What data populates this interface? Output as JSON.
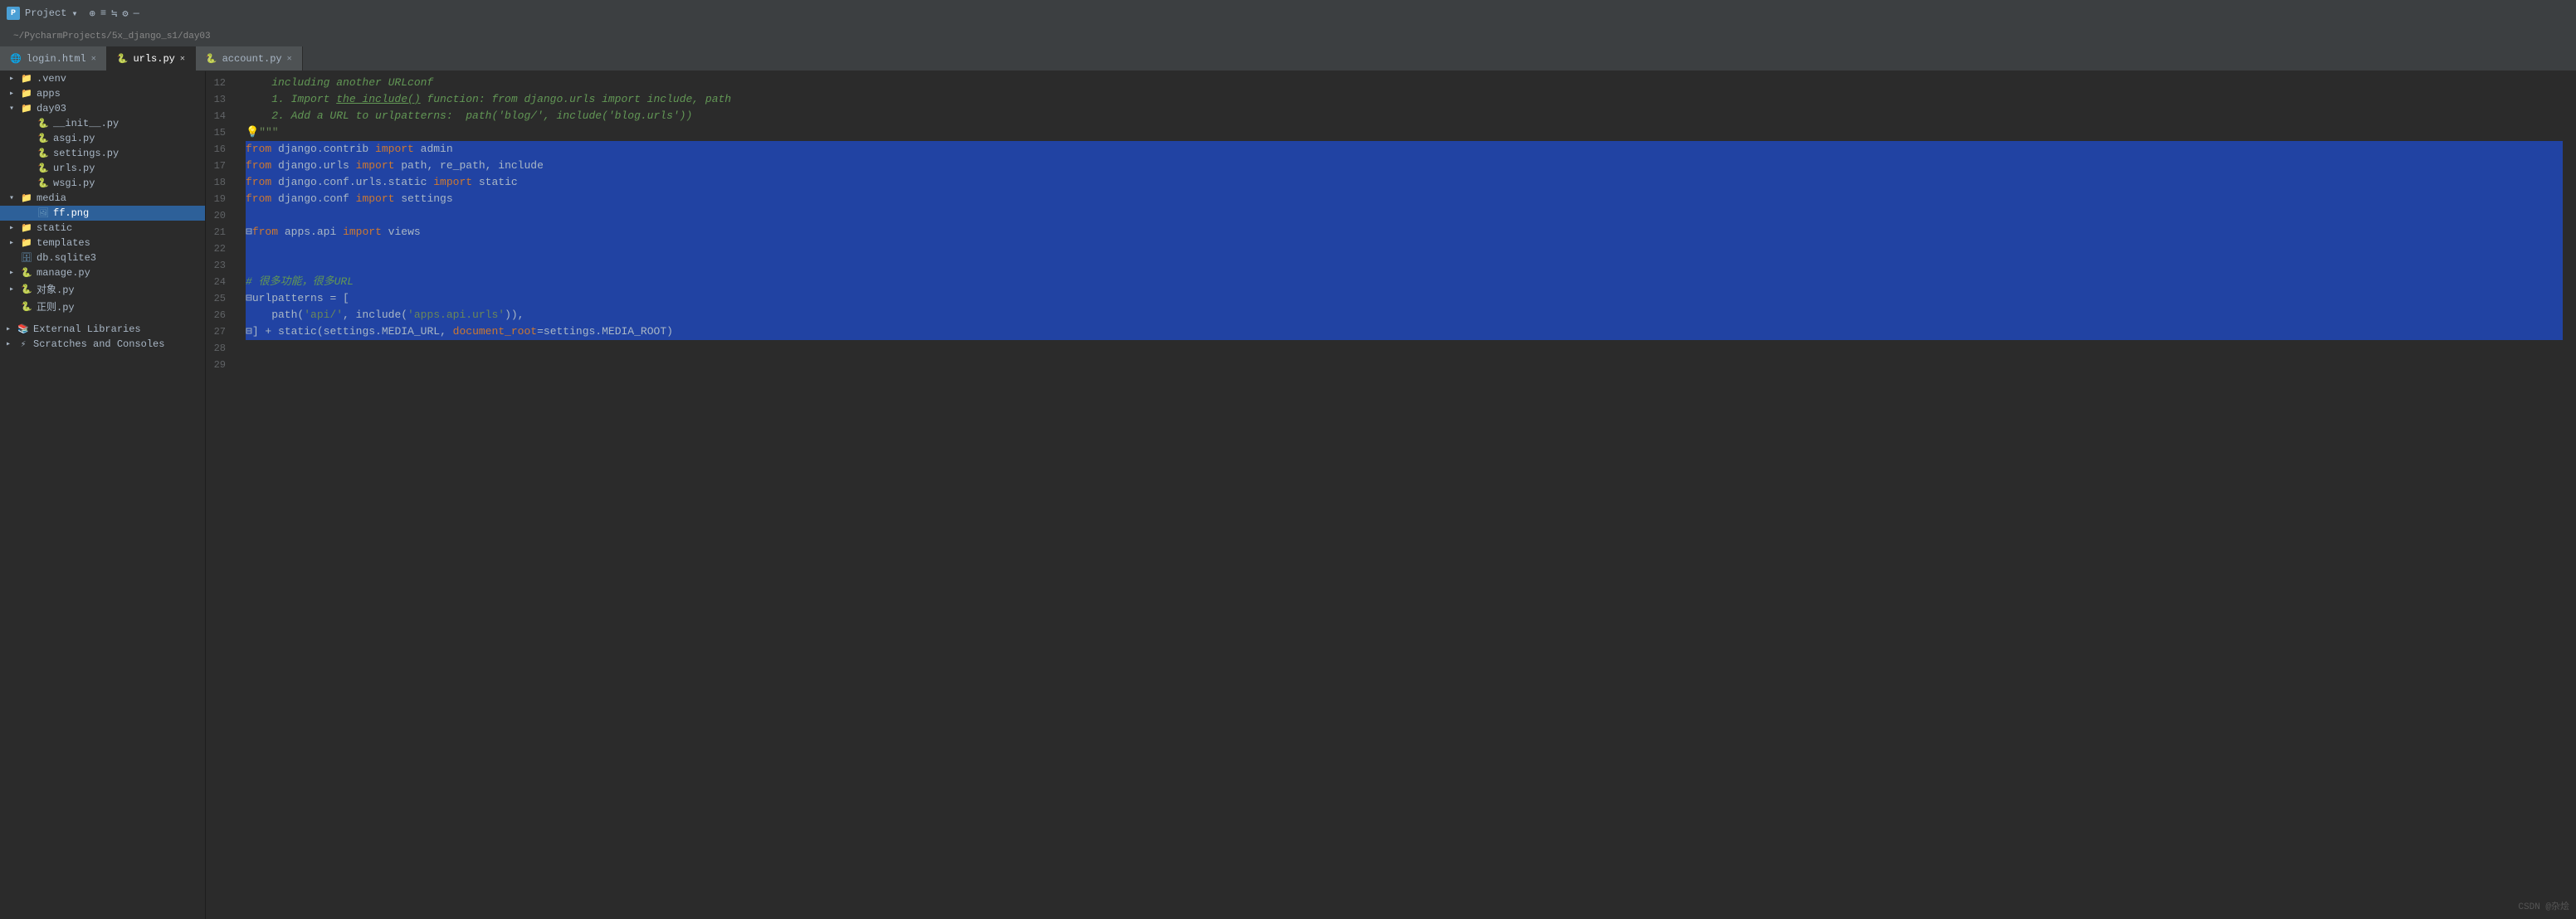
{
  "titleBar": {
    "projectLabel": "Project",
    "projectPath": "~/PycharmProjects/5x_django_s1/day03",
    "settingsLabel": "⚙",
    "minimizeLabel": "—",
    "maximizeLabel": "□",
    "closeLabel": "✕"
  },
  "tabs": [
    {
      "id": "login",
      "label": "login.html",
      "icon": "🌐",
      "active": false
    },
    {
      "id": "urls",
      "label": "urls.py",
      "icon": "🐍",
      "active": true
    },
    {
      "id": "account",
      "label": "account.py",
      "icon": "🐍",
      "active": false
    }
  ],
  "sidebar": {
    "items": [
      {
        "id": "venv",
        "label": ".venv",
        "indent": 1,
        "type": "folder",
        "expanded": false
      },
      {
        "id": "apps",
        "label": "apps",
        "indent": 1,
        "type": "folder",
        "expanded": false
      },
      {
        "id": "day03",
        "label": "day03",
        "indent": 1,
        "type": "folder",
        "expanded": true
      },
      {
        "id": "init",
        "label": "__init__.py",
        "indent": 2,
        "type": "py"
      },
      {
        "id": "asgi",
        "label": "asgi.py",
        "indent": 2,
        "type": "py"
      },
      {
        "id": "settings",
        "label": "settings.py",
        "indent": 2,
        "type": "py"
      },
      {
        "id": "urls",
        "label": "urls.py",
        "indent": 2,
        "type": "py"
      },
      {
        "id": "wsgi",
        "label": "wsgi.py",
        "indent": 2,
        "type": "py"
      },
      {
        "id": "media",
        "label": "media",
        "indent": 1,
        "type": "folder",
        "expanded": true
      },
      {
        "id": "ffpng",
        "label": "ff.png",
        "indent": 2,
        "type": "png",
        "selected": true
      },
      {
        "id": "static",
        "label": "static",
        "indent": 1,
        "type": "folder",
        "expanded": false
      },
      {
        "id": "templates",
        "label": "templates",
        "indent": 1,
        "type": "folder",
        "expanded": false
      },
      {
        "id": "dbsqlite",
        "label": "db.sqlite3",
        "indent": 1,
        "type": "db"
      },
      {
        "id": "managepy",
        "label": "manage.py",
        "indent": 1,
        "type": "py",
        "hasArrow": true
      },
      {
        "id": "duixiang",
        "label": "对象.py",
        "indent": 1,
        "type": "py",
        "hasArrow": true
      },
      {
        "id": "zeze",
        "label": "正则.py",
        "indent": 1,
        "type": "py"
      },
      {
        "id": "extlibs",
        "label": "External Libraries",
        "indent": 0,
        "type": "folder",
        "expanded": false
      },
      {
        "id": "scratches",
        "label": "Scratches and Consoles",
        "indent": 0,
        "type": "folder",
        "expanded": false
      }
    ]
  },
  "editor": {
    "filename": "urls.py",
    "lines": [
      {
        "num": 12,
        "content": "including another URLconf",
        "type": "comment-cont",
        "selected": false
      },
      {
        "num": 13,
        "content": "    1. Import the include() function: from django.urls import include, path",
        "type": "comment-cont",
        "selected": false
      },
      {
        "num": 14,
        "content": "    2. Add a URL to urlpatterns:  path('blog/', include('blog.urls'))",
        "type": "comment-cont",
        "selected": false
      },
      {
        "num": 15,
        "content": "\"\"\"",
        "type": "docstring-end",
        "selected": false
      },
      {
        "num": 16,
        "content": "from django.contrib import admin",
        "type": "import",
        "selected": true
      },
      {
        "num": 17,
        "content": "from django.urls import path, re_path, include",
        "type": "import",
        "selected": true
      },
      {
        "num": 18,
        "content": "from django.conf.urls.static import static",
        "type": "import",
        "selected": true
      },
      {
        "num": 19,
        "content": "from django.conf import settings",
        "type": "import",
        "selected": true
      },
      {
        "num": 20,
        "content": "",
        "type": "blank",
        "selected": true
      },
      {
        "num": 21,
        "content": "from apps.api import views",
        "type": "import",
        "selected": true
      },
      {
        "num": 22,
        "content": "",
        "type": "blank",
        "selected": true
      },
      {
        "num": 23,
        "content": "",
        "type": "blank",
        "selected": true
      },
      {
        "num": 24,
        "content": "# 很多功能，很多URL",
        "type": "comment",
        "selected": true
      },
      {
        "num": 25,
        "content": "urlpatterns = [",
        "type": "code",
        "selected": true
      },
      {
        "num": 26,
        "content": "    path('api/', include('apps.api.urls')),",
        "type": "code",
        "selected": true
      },
      {
        "num": 27,
        "content": "] + static(settings.MEDIA_URL, document_root=settings.MEDIA_ROOT)",
        "type": "code",
        "selected": true
      },
      {
        "num": 28,
        "content": "",
        "type": "blank",
        "selected": false
      },
      {
        "num": 29,
        "content": "",
        "type": "blank",
        "selected": false
      }
    ]
  },
  "watermark": "CSDN @杂烩"
}
